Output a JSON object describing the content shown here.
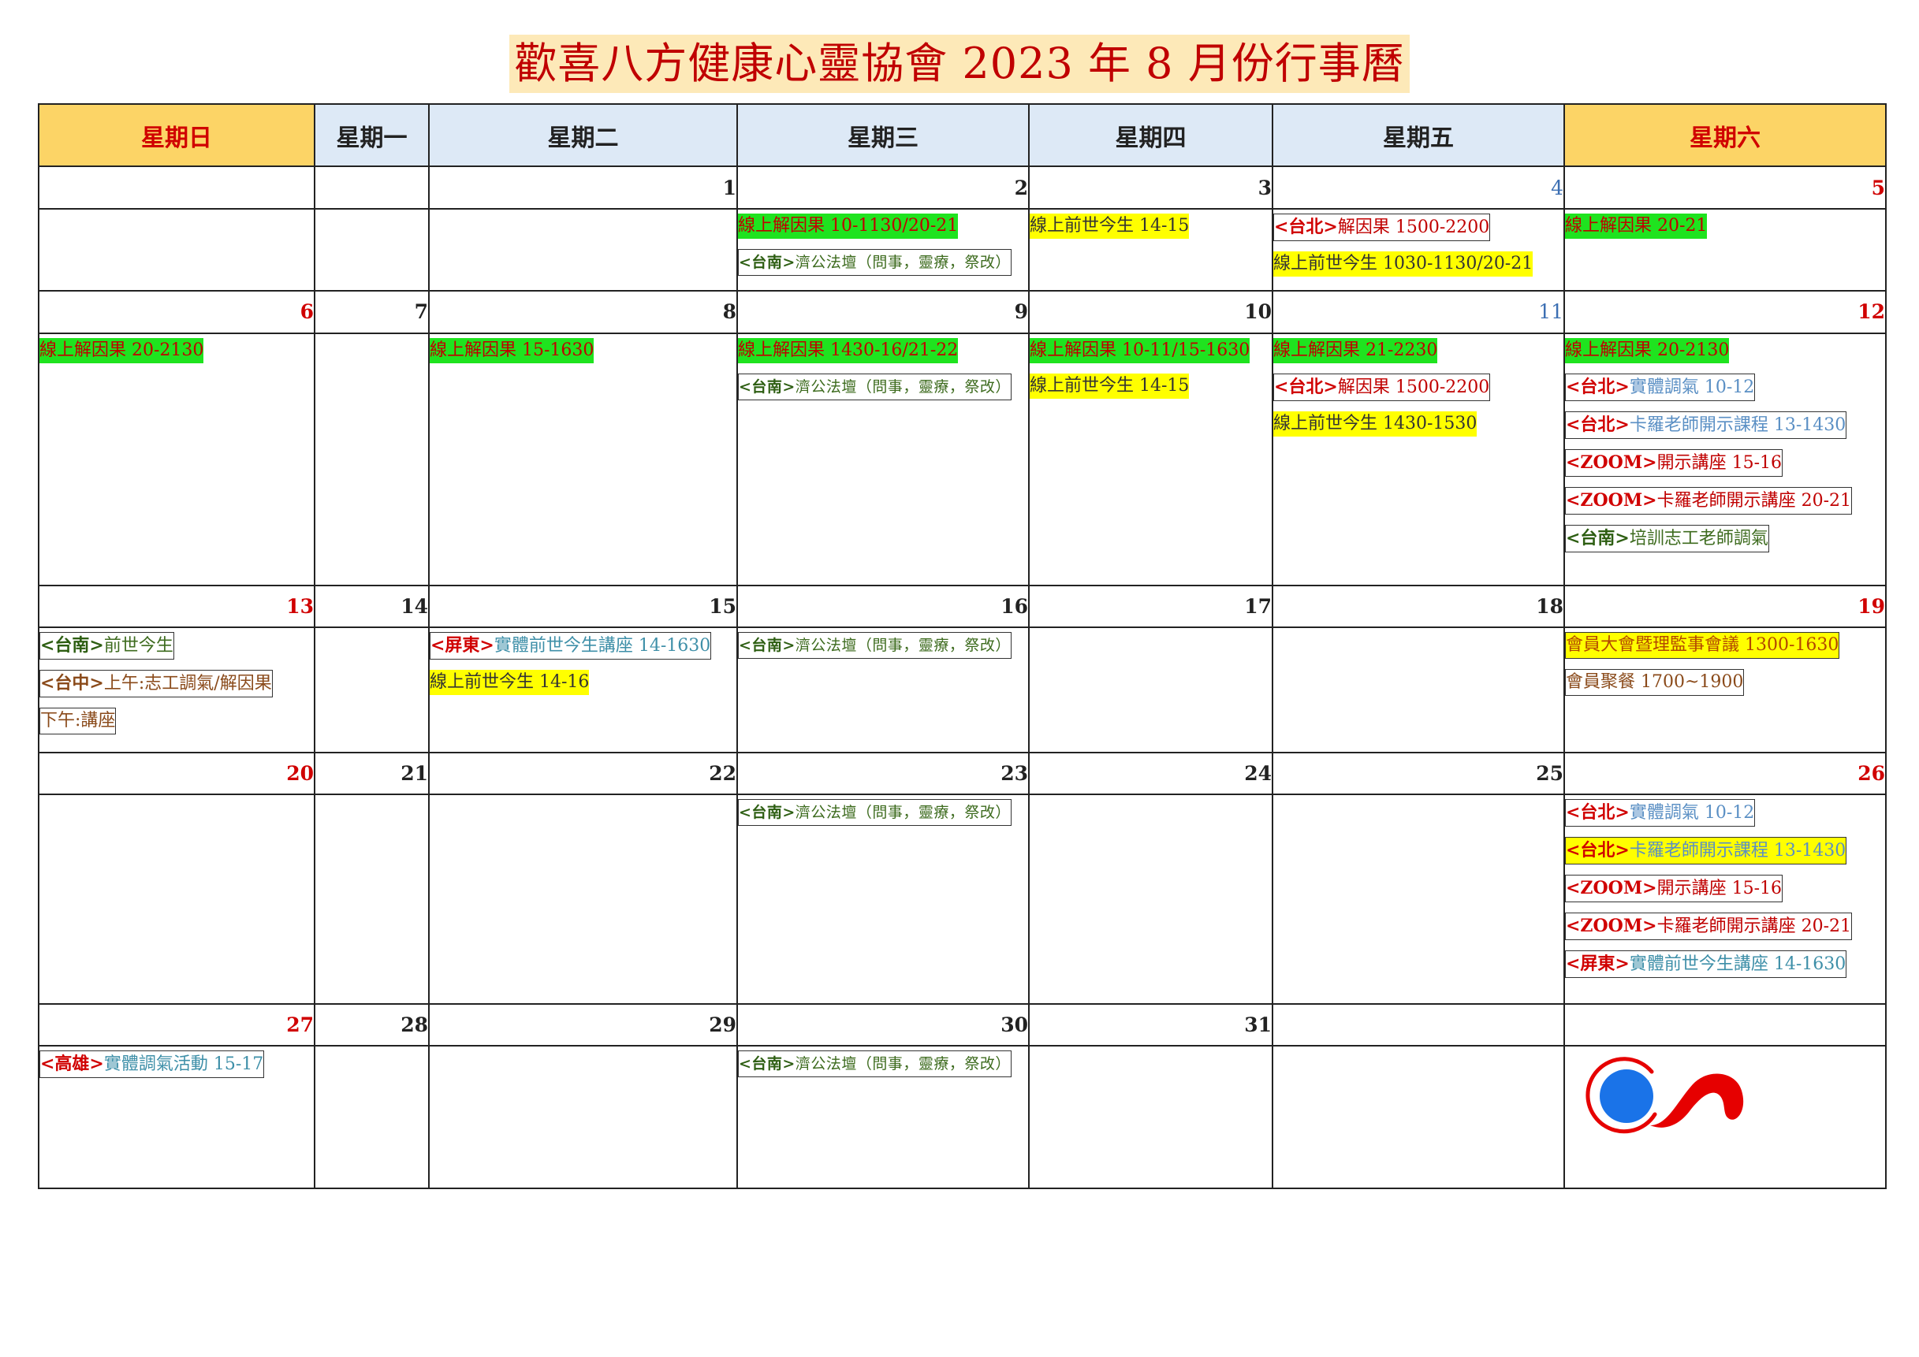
{
  "title": "歡喜八方健康心靈協會 2023 年 8 月份行事曆",
  "weekdays": [
    "星期日",
    "星期一",
    "星期二",
    "星期三",
    "星期四",
    "星期五",
    "星期六"
  ],
  "dates": {
    "d1": "1",
    "d2": "2",
    "d3": "3",
    "d4": "4",
    "d5": "5",
    "d6": "6",
    "d7": "7",
    "d8": "8",
    "d9": "9",
    "d10": "10",
    "d11": "11",
    "d12": "12",
    "d13": "13",
    "d14": "14",
    "d15": "15",
    "d16": "16",
    "d17": "17",
    "d18": "18",
    "d19": "19",
    "d20": "20",
    "d21": "21",
    "d22": "22",
    "d23": "23",
    "d24": "24",
    "d25": "25",
    "d26": "26",
    "d27": "27",
    "d28": "28",
    "d29": "29",
    "d30": "30",
    "d31": "31"
  },
  "prefix": {
    "tainan": "<台南>",
    "taipei": "<台北>",
    "zoom": "<ZOOM>",
    "pingtung": "<屏東>",
    "taichung": "<台中>",
    "kaohsiung": "<高雄>"
  },
  "events": {
    "jigong": "濟公法壇（問事，靈療，祭改）",
    "d2_karma": "線上解因果 10-1130/20-21",
    "d3_past": "線上前世今生 14-15",
    "d4_karma": "解因果 1500-2200",
    "d4_past": "線上前世今生 1030-1130/20-21",
    "d5_karma": "線上解因果 20-21",
    "d6_karma": "線上解因果 20-2130",
    "d8_karma": "線上解因果 15-1630",
    "d9_karma": "線上解因果 1430-16/21-22",
    "d10_karma": "線上解因果 10-11/15-1630",
    "d10_past": "線上前世今生 14-15",
    "d11_karma": "線上解因果 21-2230",
    "d11_karma2": "解因果 1500-2200",
    "d11_past": "線上前世今生 1430-1530",
    "d12_karma": "線上解因果 20-2130",
    "qi_10_12": "實體調氣 10-12",
    "carol_course": "卡羅老師開示課程 13-1430",
    "lecture_15_16": "開示講座 15-16",
    "carol_lecture": "卡羅老師開示講座 20-21",
    "d12_training": "培訓志工老師調氣",
    "d13_past": "前世今生",
    "d13_am": "上午:志工調氣/解因果",
    "d13_pm": "下午:講座",
    "pingtung_past": "實體前世今生講座 14-1630",
    "d15_past": "線上前世今生 14-16",
    "d19_meeting": "會員大會暨理監事會議 1300-1630",
    "d19_dinner": "會員聚餐 1700~1900",
    "d27_qi": "實體調氣活動 15-17"
  },
  "colors": {
    "title_bg": "#fde9b8",
    "title_text": "#c00000",
    "weekday_bg": "#dde9f6",
    "weekend_bg": "#fcd466",
    "event_green": "#1fe31f",
    "event_yellow": "#ffff00",
    "logo_blue": "#1a73e8",
    "logo_red": "#e60000"
  },
  "logo_icon": "association-logo"
}
